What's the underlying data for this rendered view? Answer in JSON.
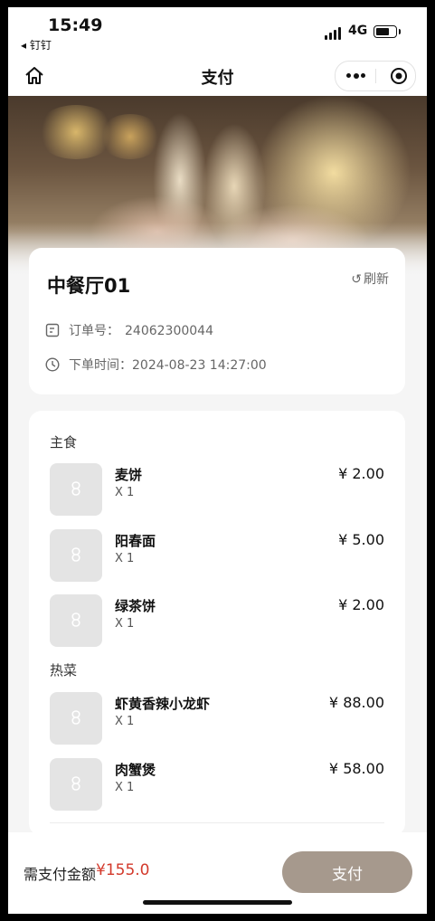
{
  "status_bar": {
    "time": "15:49",
    "back_app": "◂ 钉钉",
    "network": "4G"
  },
  "nav": {
    "title": "支付"
  },
  "store": {
    "name": "中餐厅01",
    "refresh_label": "刷新",
    "order_label": "订单号：",
    "order_no": "24062300044",
    "time_label": "下单时间：",
    "order_time": "2024-08-23 14:27:00"
  },
  "categories": [
    {
      "name": "主食",
      "items": [
        {
          "name": "麦饼",
          "qty": "X 1",
          "price": "¥ 2.00"
        },
        {
          "name": "阳春面",
          "qty": "X 1",
          "price": "¥ 5.00"
        },
        {
          "name": "绿茶饼",
          "qty": "X 1",
          "price": "¥ 2.00"
        }
      ]
    },
    {
      "name": "热菜",
      "items": [
        {
          "name": "虾黄香辣小龙虾",
          "qty": "X 1",
          "price": "¥ 88.00"
        },
        {
          "name": "肉蟹煲",
          "qty": "X 1",
          "price": "¥ 58.00"
        }
      ]
    }
  ],
  "footer": {
    "amount_label": "需支付金额",
    "amount": "¥155.0",
    "pay_button": "支付"
  },
  "colors": {
    "accent": "#a6998d",
    "amount": "#d33a2c"
  },
  "icons": {
    "home": "home-icon",
    "more": "more-icon",
    "close": "target-icon",
    "refresh": "refresh-icon",
    "order": "receipt-icon",
    "time": "clock-icon",
    "placeholder": "image-placeholder-icon"
  }
}
